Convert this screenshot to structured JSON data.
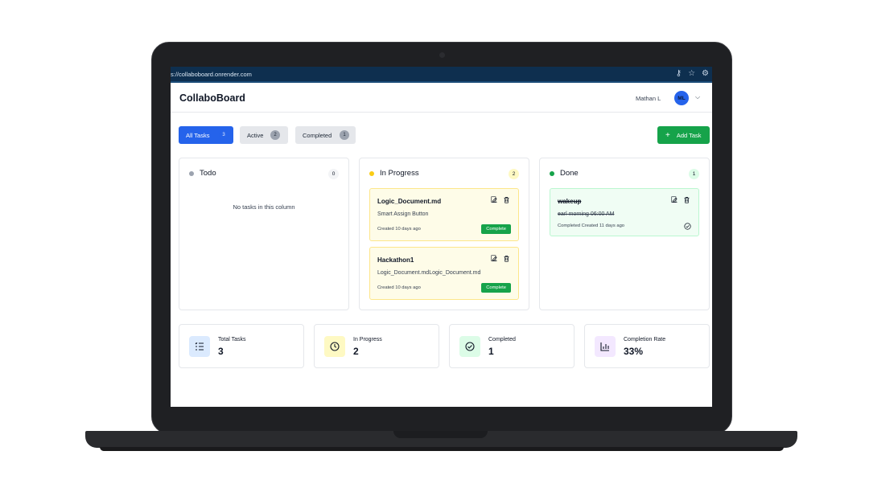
{
  "browser": {
    "url": "s://collaboboard.onrender.com"
  },
  "header": {
    "brand": "CollaboBoard",
    "username": "Mathan L",
    "avatar_initials": "ML"
  },
  "filters": {
    "all": {
      "label": "All Tasks",
      "count": "3"
    },
    "active": {
      "label": "Active",
      "count": "2"
    },
    "completed": {
      "label": "Completed",
      "count": "1"
    }
  },
  "add_task_label": "Add Task",
  "columns": {
    "todo": {
      "title": "Todo",
      "count": "0",
      "empty_text": "No tasks in this column",
      "dot_color": "#9ca3af"
    },
    "in_progress": {
      "title": "In Progress",
      "count": "2",
      "dot_color": "#facc15",
      "cards": [
        {
          "title": "Logic_Document.md",
          "description": "Smart Assign Button",
          "meta": "Created 10 days ago",
          "action": "Complete"
        },
        {
          "title": "Hackathon1",
          "description": "Logic_Document.mdLogic_Document.md",
          "meta": "Created 10 days ago",
          "action": "Complete"
        }
      ]
    },
    "done": {
      "title": "Done",
      "count": "1",
      "dot_color": "#16a34a",
      "cards": [
        {
          "title": "wakeup",
          "description": "earl morning 06:00 AM",
          "meta": "Completed Created 11 days ago"
        }
      ]
    }
  },
  "stats": [
    {
      "label": "Total Tasks",
      "value": "3",
      "icon": "list-icon",
      "color": "#dbeafe"
    },
    {
      "label": "In Progress",
      "value": "2",
      "icon": "clock-icon",
      "color": "#fef9c3"
    },
    {
      "label": "Completed",
      "value": "1",
      "icon": "check-circle-icon",
      "color": "#dcfce7"
    },
    {
      "label": "Completion Rate",
      "value": "33%",
      "icon": "bar-chart-icon",
      "color": "#f3e8ff"
    }
  ]
}
